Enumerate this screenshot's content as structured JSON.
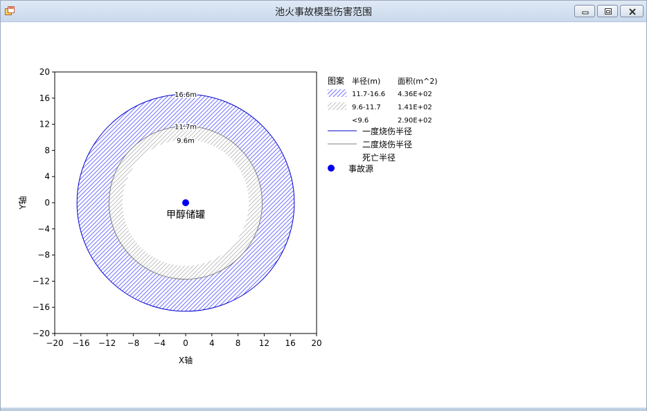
{
  "window": {
    "title": "池火事故模型伤害范围"
  },
  "colors": {
    "ring_outer": "#0000cc",
    "ring_middle": "#808080",
    "hatch_outer": "#7070ff",
    "hatch_middle": "#c0c0c0",
    "source": "#0000ee"
  },
  "icons": {
    "app": "app-icon",
    "minimize": "minimize-icon",
    "maximize": "maximize-icon",
    "close": "close-icon"
  },
  "chart_data": {
    "type": "scatter",
    "xlabel": "X轴",
    "ylabel": "Y轴",
    "xlim": [
      -20,
      20
    ],
    "ylim": [
      -20,
      20
    ],
    "xticks": [
      -20,
      -16,
      -12,
      -8,
      -4,
      0,
      4,
      8,
      12,
      16,
      20
    ],
    "yticks": [
      -20,
      -16,
      -12,
      -8,
      -4,
      0,
      4,
      8,
      12,
      16,
      20
    ],
    "grid": false,
    "legend_position": "right",
    "circles": [
      {
        "radius": 16.6,
        "label": "16.6m",
        "color": "#0000cc"
      },
      {
        "radius": 11.7,
        "label": "11.7m",
        "color": "#808080"
      },
      {
        "radius": 9.6,
        "label": "9.6m",
        "color": "#ffffff"
      }
    ],
    "zones": [
      {
        "inner": 11.7,
        "outer": 16.6,
        "hatch_color": "#7070ff"
      },
      {
        "inner": 9.6,
        "outer": 11.7,
        "hatch_color": "#c0c0c0"
      }
    ],
    "source": {
      "x": 0,
      "y": 0,
      "label": "甲醇储罐"
    },
    "legend_header": {
      "pattern": "图案",
      "radius": "半径(m)",
      "area": "面积(m^2)"
    },
    "legend_rows": [
      {
        "radius": "11.7-16.6",
        "area": "4.36E+02"
      },
      {
        "radius": "9.6-11.7",
        "area": "1.41E+02"
      },
      {
        "radius": "<9.6",
        "area": "2.90E+02"
      }
    ],
    "legend_lines": [
      {
        "label": "一度烧伤半径",
        "color": "#0000cc"
      },
      {
        "label": "二度烧伤半径",
        "color": "#808080"
      },
      {
        "label": "死亡半径",
        "color": "#ffffff"
      }
    ],
    "legend_marker": {
      "label": "事故源",
      "color": "#0000ee"
    }
  }
}
